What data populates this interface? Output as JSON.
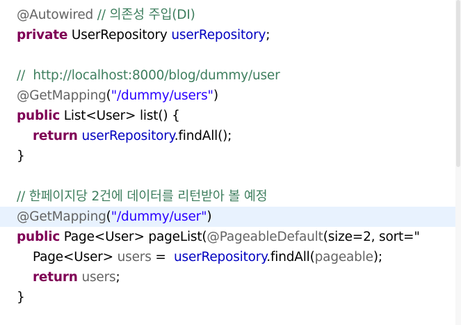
{
  "code": {
    "l1": {
      "ann": "@Autowired",
      "sep": " ",
      "comment": "// 의존성 주입(DI)"
    },
    "l2": {
      "kw": "private",
      "type": " UserRepository ",
      "field": "userRepository",
      "end": ";"
    },
    "l4": {
      "comment": "//  http://localhost:8000/blog/dummy/user"
    },
    "l5": {
      "ann": "@GetMapping",
      "open": "(",
      "str": "\"/dummy/users\"",
      "close": ")"
    },
    "l6": {
      "kw": "public",
      "rest": " List<User> list() {"
    },
    "l7": {
      "kw": "return",
      "sp": " ",
      "field": "userRepository",
      "rest": ".findAll();"
    },
    "l8": {
      "brace": "}"
    },
    "l10": {
      "comment": "// 한페이지당 2건에 데이터를 리턴받아 볼 예정"
    },
    "l11": {
      "ann": "@GetMapping",
      "open": "(",
      "str": "\"/dummy/user\"",
      "close": ")"
    },
    "l12": {
      "kw": "public",
      "rest1": " Page<User> pageList(",
      "ann": "@PageableDefault",
      "rest2": "(size=2, sort=\""
    },
    "l13": {
      "type": "Page<User> ",
      "local": "users",
      "eq": " =  ",
      "field": "userRepository",
      "call": ".findAll(",
      "local2": "pageable",
      "end": ");"
    },
    "l14": {
      "kw": "return",
      "sp": " ",
      "local": "users",
      "end": ";"
    },
    "l15": {
      "brace": "}"
    }
  },
  "colors": {
    "annotation": "#646464",
    "keyword": "#7f0055",
    "string": "#2a00ff",
    "field": "#0000c0",
    "comment": "#3f7f5f",
    "current_line": "#e8f2fe"
  }
}
